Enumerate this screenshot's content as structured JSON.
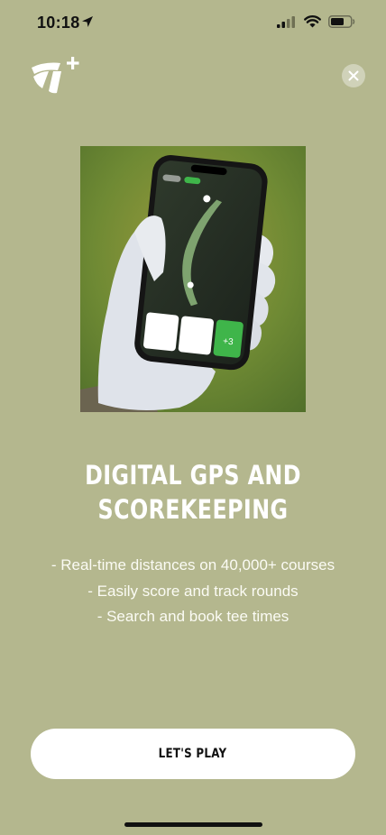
{
  "status_bar": {
    "time": "10:18",
    "icons": [
      "location-arrow-icon",
      "cellular-signal-icon",
      "wifi-icon",
      "battery-icon"
    ]
  },
  "header": {
    "logo_icon": "taylormade-plus-logo-icon",
    "close_icon": "close-icon"
  },
  "hero": {
    "image_subject": "gloved hand holding phone showing golf course GPS map"
  },
  "headline": {
    "line1": "DIGITAL GPS AND",
    "line2": "SCOREKEEPING"
  },
  "features": [
    "- Real-time distances on 40,000+ courses",
    "- Easily score and track rounds",
    "- Search and book tee times"
  ],
  "cta": {
    "label": "LET'S PLAY"
  },
  "colors": {
    "background": "#b4b78e",
    "button": "#ffffff",
    "button_text": "#111111",
    "text": "#ffffff"
  }
}
